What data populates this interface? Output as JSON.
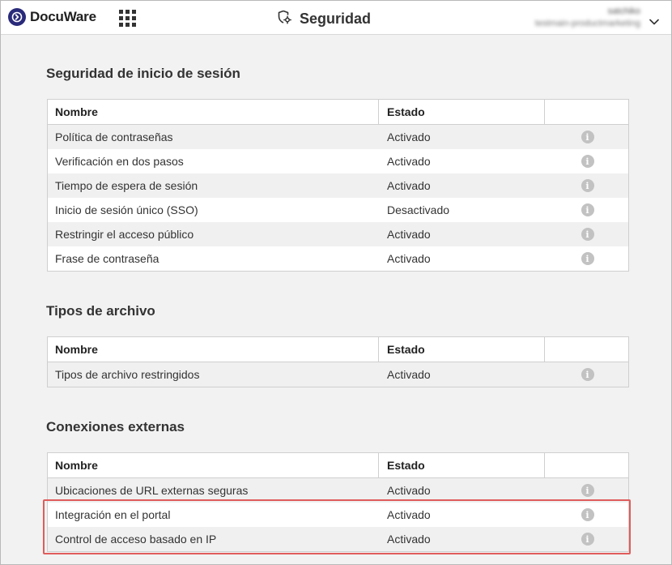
{
  "header": {
    "brand": "DocuWare",
    "title": "Seguridad",
    "user_name": "satchiko",
    "user_org": "testmain-productmarketing"
  },
  "columns": {
    "name": "Nombre",
    "status": "Estado"
  },
  "sections": [
    {
      "title": "Seguridad de inicio de sesión",
      "rows": [
        {
          "name": "Política de contraseñas",
          "status": "Activado"
        },
        {
          "name": "Verificación en dos pasos",
          "status": "Activado"
        },
        {
          "name": "Tiempo de espera de sesión",
          "status": "Activado"
        },
        {
          "name": "Inicio de sesión único (SSO)",
          "status": "Desactivado"
        },
        {
          "name": "Restringir el acceso público",
          "status": "Activado"
        },
        {
          "name": "Frase de contraseña",
          "status": "Activado"
        }
      ]
    },
    {
      "title": "Tipos de archivo",
      "rows": [
        {
          "name": "Tipos de archivo restringidos",
          "status": "Activado"
        }
      ]
    },
    {
      "title": "Conexiones externas",
      "rows": [
        {
          "name": "Ubicaciones de URL externas seguras",
          "status": "Activado"
        },
        {
          "name": "Integración en el portal",
          "status": "Activado"
        },
        {
          "name": "Control de acceso basado en IP",
          "status": "Activado"
        }
      ]
    }
  ],
  "icons": {
    "brand": "docuware-logo-icon",
    "apps": "app-grid-icon",
    "title": "security-settings-icon",
    "user_menu": "chevron-down-icon",
    "row_info": "info-icon"
  },
  "colors": {
    "brand": "#2a2a7a",
    "highlight": "#e05c5c",
    "background": "#f2f2f2"
  }
}
